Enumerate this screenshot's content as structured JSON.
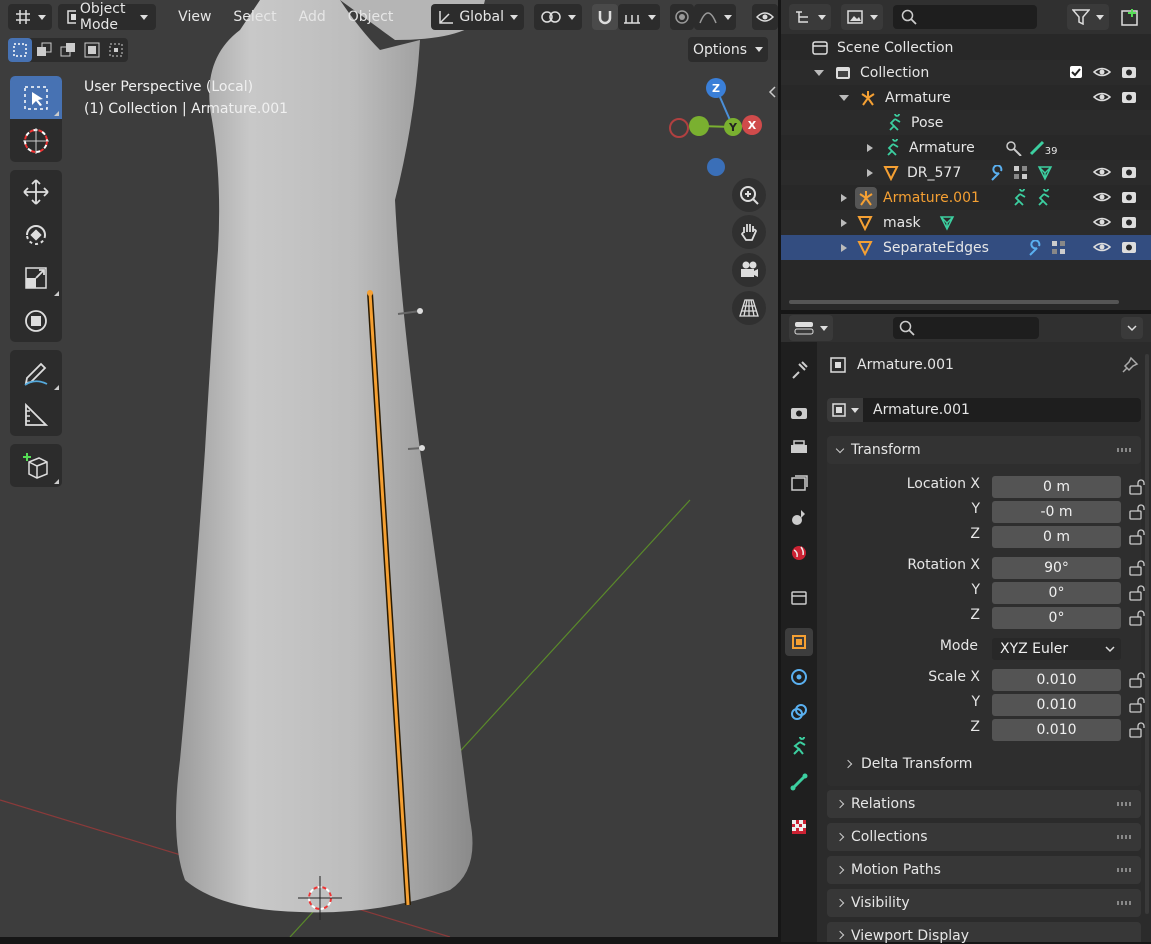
{
  "viewport": {
    "header": {
      "mode_label": "Object Mode",
      "menus": [
        "View",
        "Select",
        "Add",
        "Object"
      ],
      "orientation_label": "Global"
    },
    "options_label": "Options",
    "info_line1": "User Perspective (Local)",
    "info_line2": "(1) Collection | Armature.001",
    "gizmo": {
      "z": "Z",
      "y": "Y",
      "x": "X"
    }
  },
  "outliner": {
    "rows": [
      {
        "label": "Scene Collection",
        "indent": 0
      },
      {
        "label": "Collection",
        "indent": 1
      },
      {
        "label": "Armature",
        "indent": 2
      },
      {
        "label": "Pose",
        "indent": 3
      },
      {
        "label": "Armature",
        "indent": 3,
        "badge": "39"
      },
      {
        "label": "DR_577",
        "indent": 3
      },
      {
        "label": "Armature.001",
        "indent": 2,
        "highlight": true
      },
      {
        "label": "mask",
        "indent": 2
      },
      {
        "label": "SeparateEdges",
        "indent": 2,
        "selected": true
      }
    ]
  },
  "properties": {
    "object_title": "Armature.001",
    "object_name_field": "Armature.001",
    "panels": {
      "transform": "Transform",
      "delta_transform": "Delta Transform",
      "relations": "Relations",
      "collections": "Collections",
      "motion_paths": "Motion Paths",
      "visibility": "Visibility",
      "viewport_display": "Viewport Display"
    },
    "transform": {
      "location_label": "Location X",
      "location": [
        "0 m",
        "-0 m",
        "0 m"
      ],
      "rotation_label": "Rotation X",
      "rotation": [
        "90°",
        "0°",
        "0°"
      ],
      "mode_label": "Mode",
      "mode_value": "XYZ Euler",
      "scale_label": "Scale X",
      "scale": [
        "0.010",
        "0.010",
        "0.010"
      ],
      "axis_y": "Y",
      "axis_z": "Z"
    }
  },
  "colors": {
    "accent": "#4772b3",
    "selection_orange": "#f5a033",
    "highlight_text": "#f5a033"
  }
}
